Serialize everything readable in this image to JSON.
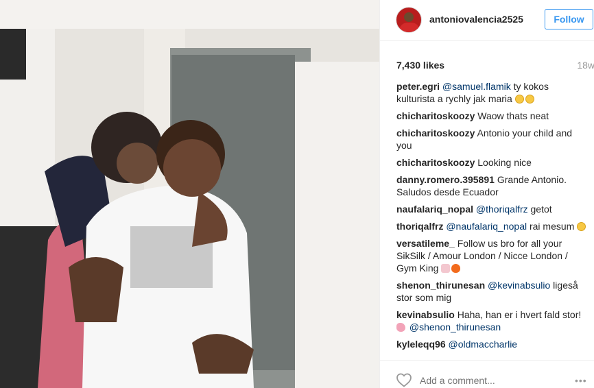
{
  "post": {
    "username": "antoniovalencia2525",
    "follow_label": "Follow",
    "likes": "7,430 likes",
    "age": "18w"
  },
  "comments": [
    {
      "user": "peter.egri",
      "mention": "@samuel.flamik",
      "text": " ty kokos kulturista a rychly jak maria",
      "emoji": [
        "laughing-face",
        "laughing-face"
      ]
    },
    {
      "user": "chicharitoskoozy",
      "text": "Waow thats neat"
    },
    {
      "user": "chicharitoskoozy",
      "text": "Antonio your child and you"
    },
    {
      "user": "chicharitoskoozy",
      "text": "Looking nice"
    },
    {
      "user": "danny.romero.395891",
      "text": "Grande Antonio. Saludos desde Ecuador"
    },
    {
      "user": "naufalariq_nopal",
      "mention": "@thoriqalfrz",
      "text": " getot"
    },
    {
      "user": "thoriqalfrz",
      "mention": "@naufalariq_nopal",
      "text": " rai mesum",
      "emoji": [
        "laughing-face"
      ]
    },
    {
      "user": "versatileme_",
      "text": "Follow us bro for all your SikSilk / Amour London / Nicce London / Gym King",
      "emoji": [
        "praying-hands",
        "fire"
      ]
    },
    {
      "user": "shenon_thirunesan",
      "mention": "@kevinabsulio",
      "text": " ligeså stor som mig"
    },
    {
      "user": "kevinabsulio",
      "text": "Haha, han er i hvert fald stor!",
      "emoji_mid": "flexed-biceps",
      "mention2": "@shenon_thirunesan"
    },
    {
      "user": "kyleleqq96",
      "mention": "@oldmaccharlie",
      "text": ""
    }
  ],
  "footer": {
    "add_comment_placeholder": "Add a comment...",
    "more_label": "•••"
  },
  "icons": {
    "like": "heart-outline-icon",
    "more": "more-options-icon"
  },
  "colors": {
    "follow_blue": "#3897f0",
    "mention_blue": "#003569",
    "muted": "#999999",
    "text": "#262626"
  }
}
